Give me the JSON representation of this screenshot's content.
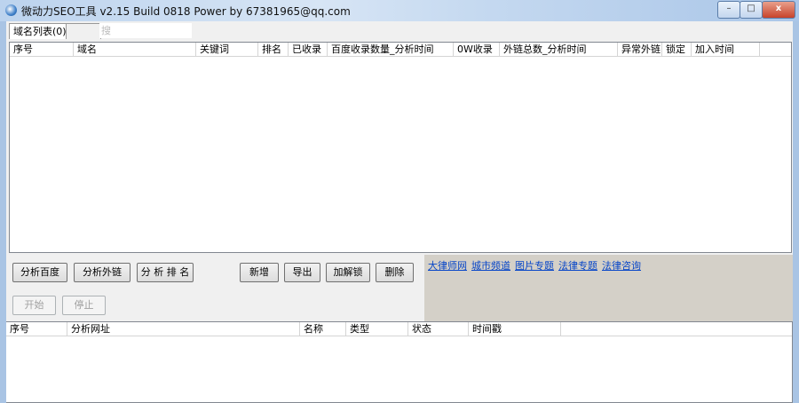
{
  "window": {
    "title": "微动力SEO工具 v2.15 Build 0818 Power by 67381965@qq.com",
    "minimize": "–",
    "maximize": "□",
    "close": "x"
  },
  "tabs": [
    {
      "label": "域名列表(0)"
    }
  ],
  "search": {
    "placeholder": "搜"
  },
  "domain_table": {
    "columns": [
      "序号",
      "域名",
      "关键词",
      "排名",
      "已收录",
      "百度收录数量_分析时间",
      "0W收录",
      "外链总数_分析时间",
      "异常外链",
      "锁定",
      "加入时间"
    ]
  },
  "buttons": {
    "analyze_baidu": "分析百度",
    "analyze_links": "分析外链",
    "analyze_rank": "分 析 排 名",
    "add": "新增",
    "export": "导出",
    "lock": "加解锁",
    "delete": "删除",
    "start": "开始",
    "stop": "停止"
  },
  "links": [
    "大律师网",
    "城市频道",
    "图片专题",
    "法律专题",
    "法律咨询"
  ],
  "task_table": {
    "columns": [
      "序号",
      "分析网址",
      "名称",
      "类型",
      "状态",
      "时间戳"
    ]
  }
}
